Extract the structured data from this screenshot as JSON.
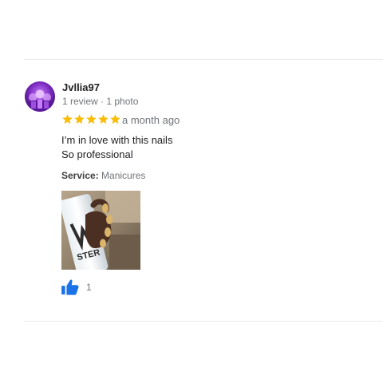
{
  "review": {
    "author": "Jvllia97",
    "meta": "1 review · 1 photo",
    "rating": 5,
    "rating_max": 5,
    "date": "a month ago",
    "text_lines": [
      "I’m in love with this nails",
      "So professional"
    ],
    "service_label": "Service:",
    "service_value": "Manicures",
    "like_count": "1",
    "star_color": "#fbbc04",
    "like_color": "#1a73e8"
  },
  "icons": {
    "avatar": "avatar",
    "stars": "star-icon",
    "like": "thumbs-up-icon"
  }
}
